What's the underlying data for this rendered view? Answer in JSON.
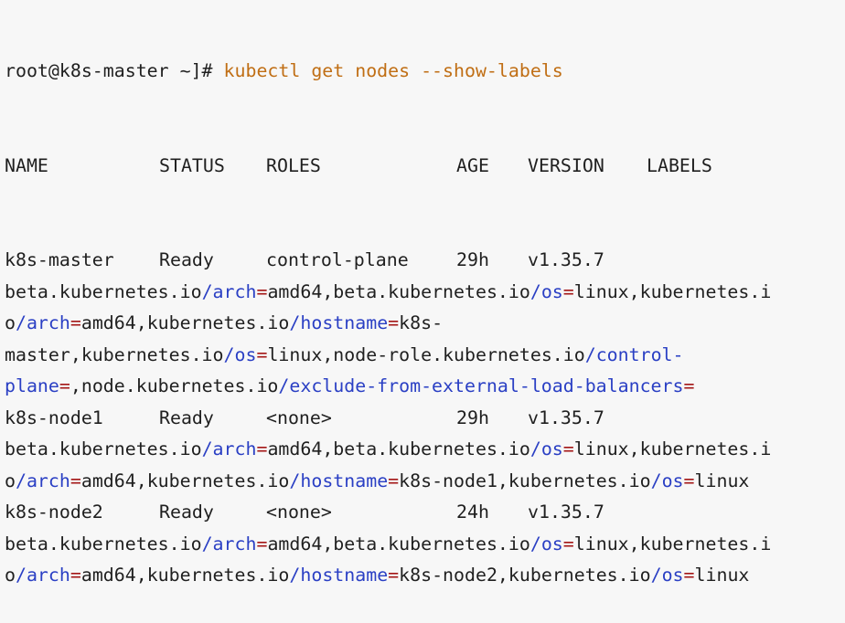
{
  "terminal": {
    "prompt": "root@k8s-master ~]#",
    "command": "kubectl get nodes --show-labels",
    "headers": [
      "NAME",
      "STATUS",
      "ROLES",
      "AGE",
      "VERSION",
      "LABELS"
    ],
    "colors": {
      "text": "#1f1f1f",
      "command": "#c06e14",
      "path_key": "#2a3fc4",
      "equals_sign": "#a31515",
      "background": "#f7f7f7"
    },
    "nodes": [
      {
        "name": "k8s-master",
        "status": "Ready",
        "roles": "control-plane",
        "age": "29h",
        "version": "v1.35.7",
        "label_lines": [
          [
            {
              "t": "beta.kubernetes.io",
              "c": "plain"
            },
            {
              "t": "/arch",
              "c": "blue"
            },
            {
              "t": "=",
              "c": "red"
            },
            {
              "t": "amd64,beta.kubernetes.io",
              "c": "plain"
            },
            {
              "t": "/os",
              "c": "blue"
            },
            {
              "t": "=",
              "c": "red"
            },
            {
              "t": "linux,kubernetes.i",
              "c": "plain"
            }
          ],
          [
            {
              "t": "o",
              "c": "plain"
            },
            {
              "t": "/arch",
              "c": "blue"
            },
            {
              "t": "=",
              "c": "red"
            },
            {
              "t": "amd64,kubernetes.io",
              "c": "plain"
            },
            {
              "t": "/hostname",
              "c": "blue"
            },
            {
              "t": "=",
              "c": "red"
            },
            {
              "t": "k8s-",
              "c": "plain"
            }
          ],
          [
            {
              "t": "master,kubernetes.io",
              "c": "plain"
            },
            {
              "t": "/os",
              "c": "blue"
            },
            {
              "t": "=",
              "c": "red"
            },
            {
              "t": "linux,node-role.kubernetes.io",
              "c": "plain"
            },
            {
              "t": "/control-",
              "c": "blue"
            }
          ],
          [
            {
              "t": "plane",
              "c": "blue"
            },
            {
              "t": "=",
              "c": "red"
            },
            {
              "t": ",node.kubernetes.io",
              "c": "plain"
            },
            {
              "t": "/exclude-from-external-load-balancers",
              "c": "blue"
            },
            {
              "t": "=",
              "c": "red"
            }
          ]
        ]
      },
      {
        "name": "k8s-node1",
        "status": "Ready",
        "roles": "<none>",
        "age": "29h",
        "version": "v1.35.7",
        "label_lines": [
          [
            {
              "t": "beta.kubernetes.io",
              "c": "plain"
            },
            {
              "t": "/arch",
              "c": "blue"
            },
            {
              "t": "=",
              "c": "red"
            },
            {
              "t": "amd64,beta.kubernetes.io",
              "c": "plain"
            },
            {
              "t": "/os",
              "c": "blue"
            },
            {
              "t": "=",
              "c": "red"
            },
            {
              "t": "linux,kubernetes.i",
              "c": "plain"
            }
          ],
          [
            {
              "t": "o",
              "c": "plain"
            },
            {
              "t": "/arch",
              "c": "blue"
            },
            {
              "t": "=",
              "c": "red"
            },
            {
              "t": "amd64,kubernetes.io",
              "c": "plain"
            },
            {
              "t": "/hostname",
              "c": "blue"
            },
            {
              "t": "=",
              "c": "red"
            },
            {
              "t": "k8s-node1,kubernetes.io",
              "c": "plain"
            },
            {
              "t": "/os",
              "c": "blue"
            },
            {
              "t": "=",
              "c": "red"
            },
            {
              "t": "linux",
              "c": "plain"
            }
          ]
        ]
      },
      {
        "name": "k8s-node2",
        "status": "Ready",
        "roles": "<none>",
        "age": "24h",
        "version": "v1.35.7",
        "label_lines": [
          [
            {
              "t": "beta.kubernetes.io",
              "c": "plain"
            },
            {
              "t": "/arch",
              "c": "blue"
            },
            {
              "t": "=",
              "c": "red"
            },
            {
              "t": "amd64,beta.kubernetes.io",
              "c": "plain"
            },
            {
              "t": "/os",
              "c": "blue"
            },
            {
              "t": "=",
              "c": "red"
            },
            {
              "t": "linux,kubernetes.i",
              "c": "plain"
            }
          ],
          [
            {
              "t": "o",
              "c": "plain"
            },
            {
              "t": "/arch",
              "c": "blue"
            },
            {
              "t": "=",
              "c": "red"
            },
            {
              "t": "amd64,kubernetes.io",
              "c": "plain"
            },
            {
              "t": "/hostname",
              "c": "blue"
            },
            {
              "t": "=",
              "c": "red"
            },
            {
              "t": "k8s-node2,kubernetes.io",
              "c": "plain"
            },
            {
              "t": "/os",
              "c": "blue"
            },
            {
              "t": "=",
              "c": "red"
            },
            {
              "t": "linux",
              "c": "plain"
            }
          ]
        ]
      }
    ]
  }
}
